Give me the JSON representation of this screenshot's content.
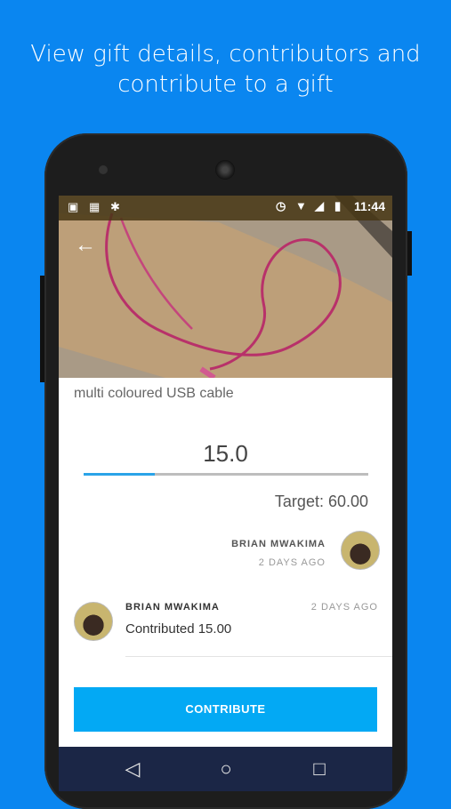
{
  "caption": {
    "line1": "View gift details, contributors and",
    "line2": "contribute to a gift"
  },
  "status_bar": {
    "time": "11:44",
    "left_icons": [
      "image-icon",
      "sim-icon",
      "android-icon"
    ],
    "right_icons": [
      "alarm-icon",
      "wifi-icon",
      "signal-icon",
      "battery-charging-icon"
    ]
  },
  "gift": {
    "title": "multi coloured USB cable",
    "amount": "15.0",
    "progress_fraction": 0.25,
    "target": "Target: 60.00"
  },
  "owner": {
    "name": "BRIAN MWAKIMA",
    "time": "2 DAYS AGO"
  },
  "contributors": [
    {
      "name": "BRIAN MWAKIMA",
      "time": "2 DAYS AGO",
      "text": "Contributed 15.00"
    }
  ],
  "actions": {
    "contribute_label": "CONTRIBUTE"
  },
  "colors": {
    "background": "#0a86f0",
    "accent": "#03a9f4",
    "navbar": "#1b2646"
  },
  "nav": {
    "back": "◁",
    "home": "○",
    "recents": "□"
  }
}
